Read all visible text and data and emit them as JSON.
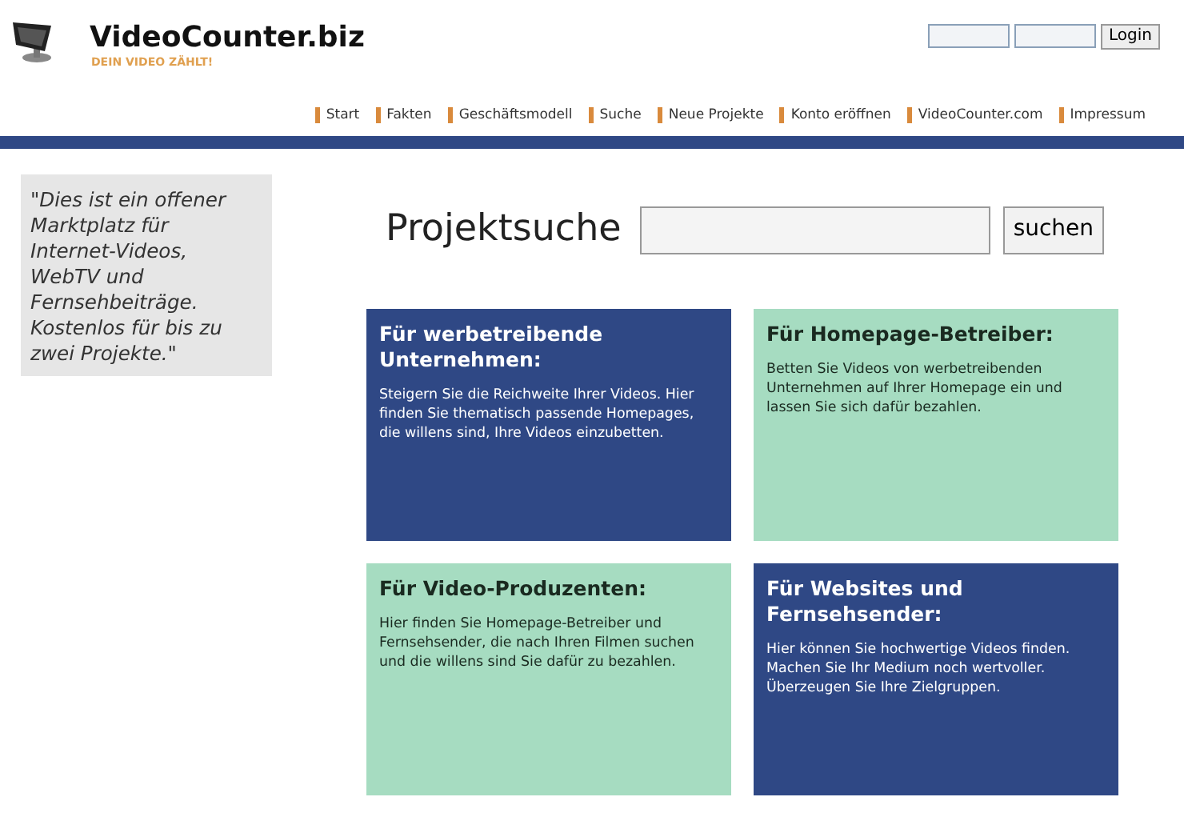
{
  "header": {
    "title": "VideoCounter.biz",
    "tagline": "DEIN VIDEO ZÄHLT!",
    "login_button": "Login"
  },
  "nav": [
    "Start",
    "Fakten",
    "Geschäftsmodell",
    "Suche",
    "Neue Projekte",
    "Konto eröffnen",
    "VideoCounter.com",
    "Impressum"
  ],
  "quote": "\"Dies ist ein offener Marktplatz für Internet-Videos, WebTV und Fernsehbeiträge. Kostenlos für bis zu zwei Projekte.\"",
  "search": {
    "title": "Projektsuche",
    "button": "suchen"
  },
  "tiles": [
    {
      "title": "Für werbetreibende Unternehmen:",
      "text": "Steigern Sie die Reichweite Ihrer Videos. Hier finden Sie thematisch passende Homepages, die willens sind, Ihre Videos einzubetten.",
      "color": "#2f4885"
    },
    {
      "title": "Für Homepage-Betreiber:",
      "text": "Betten Sie Videos von werbetreibenden Unternehmen auf Ihrer Homepage ein und lassen Sie sich dafür bezahlen.",
      "color": "#a6dcc1"
    },
    {
      "title": "Für Video-Produzenten:",
      "text": "Hier finden Sie Homepage-Betreiber und Fernsehsender, die nach Ihren Filmen suchen und die willens sind Sie dafür zu bezahlen.",
      "color": "#a6dcc1"
    },
    {
      "title": "Für Websites und Fernsehsender:",
      "text": "Hier können Sie hochwertige Videos finden. Machen Sie Ihr Medium noch wertvoller. Überzeugen Sie Ihre Zielgruppen.",
      "color": "#2f4885"
    }
  ]
}
